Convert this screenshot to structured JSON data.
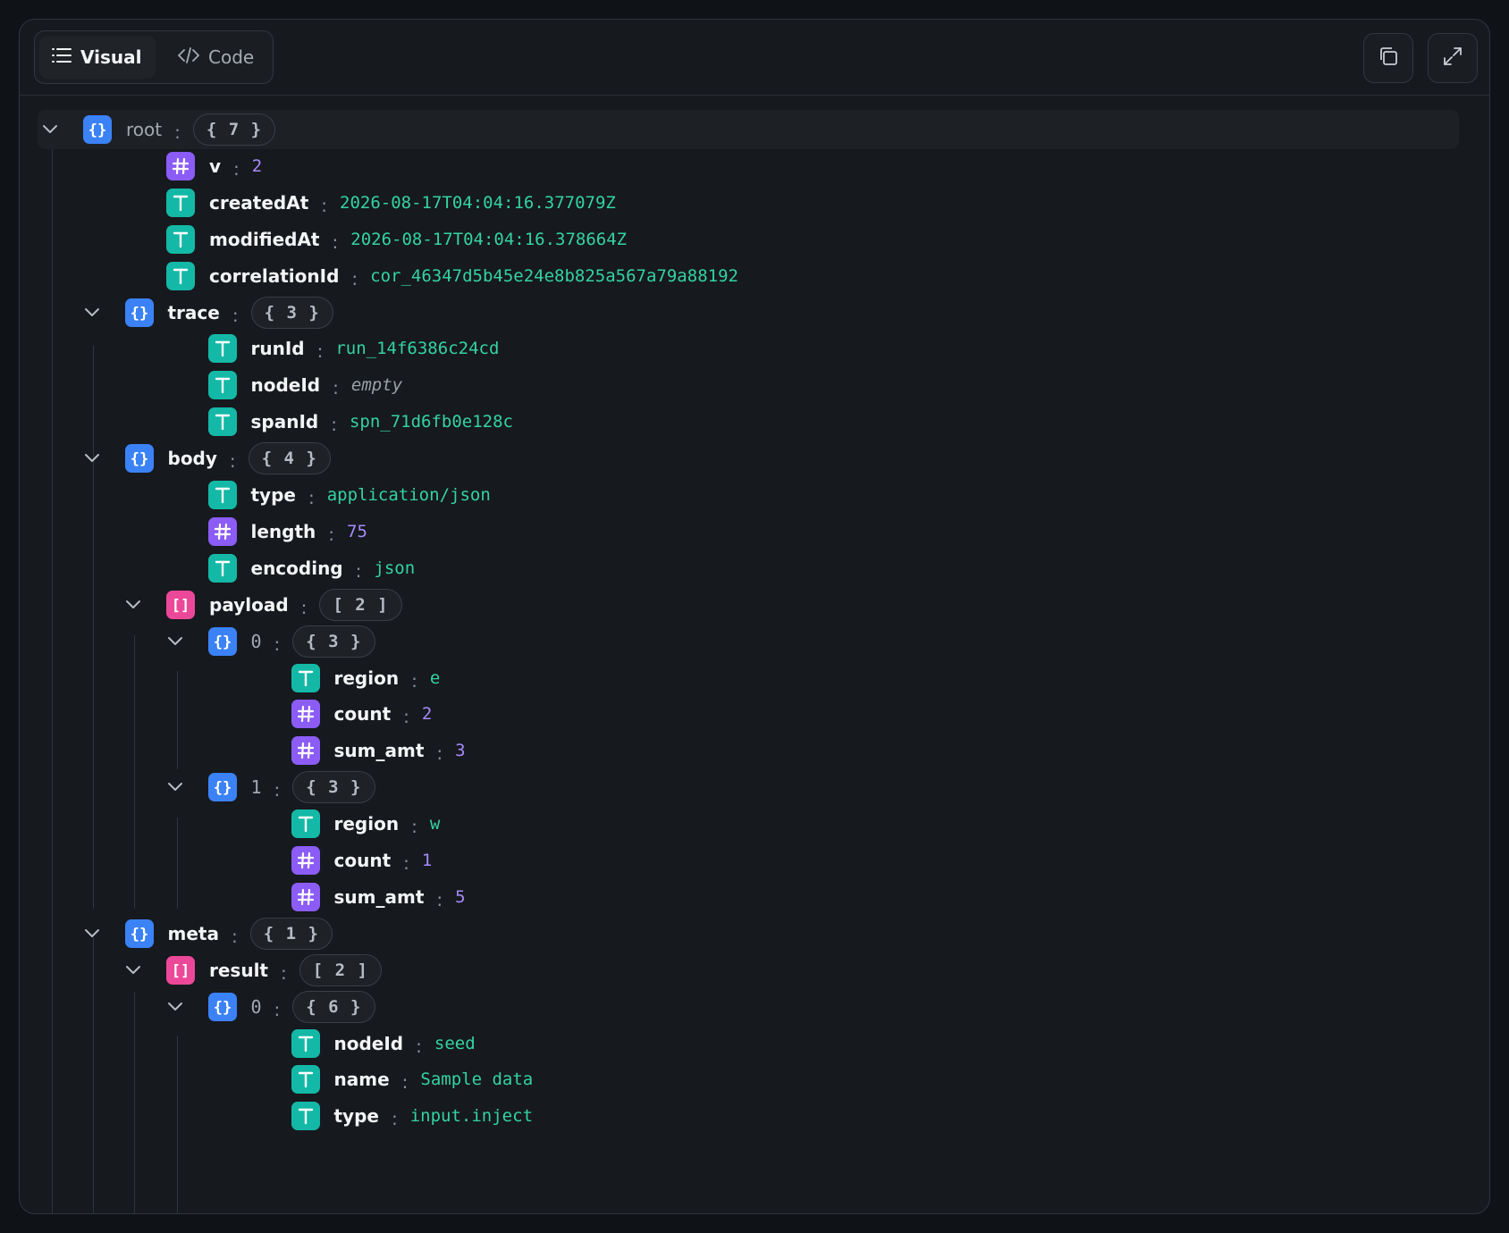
{
  "toolbar": {
    "visual_label": "Visual",
    "code_label": "Code",
    "copy_icon": "copy-icon",
    "expand_icon": "expand-icon"
  },
  "colors": {
    "object": "#3b82f6",
    "number": "#8b5cf6",
    "string": "#14b8a6",
    "array": "#ec4899"
  },
  "tree": [
    {
      "key": "root",
      "kind": "object",
      "count": "{ 7 }",
      "expanded": true
    },
    {
      "key": "v",
      "kind": "number",
      "value": "2"
    },
    {
      "key": "createdAt",
      "kind": "string",
      "value": "2026-08-17T04:04:16.377079Z"
    },
    {
      "key": "modifiedAt",
      "kind": "string",
      "value": "2026-08-17T04:04:16.378664Z"
    },
    {
      "key": "correlationId",
      "kind": "string",
      "value": "cor_46347d5b45e24e8b825a567a79a88192"
    },
    {
      "key": "trace",
      "kind": "object",
      "count": "{ 3 }",
      "expanded": true
    },
    {
      "key": "runId",
      "kind": "string",
      "value": "run_14f6386c24cd"
    },
    {
      "key": "nodeId",
      "kind": "string",
      "value": "empty"
    },
    {
      "key": "spanId",
      "kind": "string",
      "value": "spn_71d6fb0e128c"
    },
    {
      "key": "body",
      "kind": "object",
      "count": "{ 4 }",
      "expanded": true
    },
    {
      "key": "type",
      "kind": "string",
      "value": "application/json"
    },
    {
      "key": "length",
      "kind": "number",
      "value": "75"
    },
    {
      "key": "encoding",
      "kind": "string",
      "value": "json"
    },
    {
      "key": "payload",
      "kind": "array",
      "count": "[ 2 ]",
      "expanded": true
    },
    {
      "key": "0",
      "kind": "object",
      "count": "{ 3 }",
      "expanded": true
    },
    {
      "key": "region",
      "kind": "string",
      "value": "e"
    },
    {
      "key": "count",
      "kind": "number",
      "value": "2"
    },
    {
      "key": "sum_amt",
      "kind": "number",
      "value": "3"
    },
    {
      "key": "1",
      "kind": "object",
      "count": "{ 3 }",
      "expanded": true
    },
    {
      "key": "region",
      "kind": "string",
      "value": "w"
    },
    {
      "key": "count",
      "kind": "number",
      "value": "1"
    },
    {
      "key": "sum_amt",
      "kind": "number",
      "value": "5"
    },
    {
      "key": "meta",
      "kind": "object",
      "count": "{ 1 }",
      "expanded": true
    },
    {
      "key": "result",
      "kind": "array",
      "count": "[ 2 ]",
      "expanded": true
    },
    {
      "key": "0",
      "kind": "object",
      "count": "{ 6 }",
      "expanded": true
    },
    {
      "key": "nodeId",
      "kind": "string",
      "value": "seed"
    },
    {
      "key": "name",
      "kind": "string",
      "value": "Sample data"
    },
    {
      "key": "type",
      "kind": "string",
      "value": "input.inject"
    }
  ]
}
